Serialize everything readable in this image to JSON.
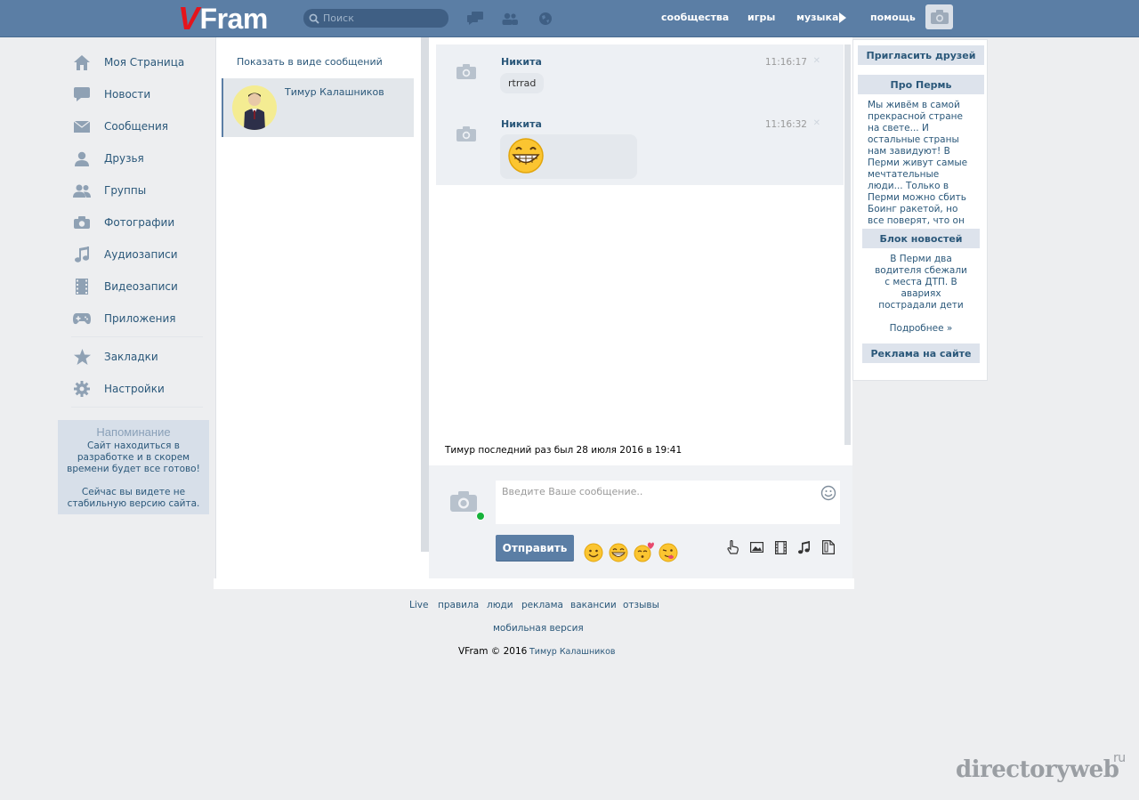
{
  "header": {
    "logo_v": "V",
    "logo_rest": "Fram",
    "search_placeholder": "Поиск",
    "nav": [
      "сообщества",
      "игры",
      "музыка",
      "помощь"
    ]
  },
  "sidebar": {
    "items": [
      {
        "label": "Моя Страница",
        "icon": "home-icon"
      },
      {
        "label": "Новости",
        "icon": "news-icon"
      },
      {
        "label": "Сообщения",
        "icon": "envelope-icon"
      },
      {
        "label": "Друзья",
        "icon": "user-icon"
      },
      {
        "label": "Группы",
        "icon": "group-icon"
      },
      {
        "label": "Фотографии",
        "icon": "camera-icon"
      },
      {
        "label": "Аудиозаписи",
        "icon": "music-note-icon"
      },
      {
        "label": "Видеозаписи",
        "icon": "film-icon"
      },
      {
        "label": "Приложения",
        "icon": "gamepad-icon"
      },
      {
        "label": "Закладки",
        "icon": "star-icon"
      },
      {
        "label": "Настройки",
        "icon": "gear-icon"
      }
    ],
    "reminder": {
      "title": "Напоминание",
      "text1": "Сайт находиться в разработке и в скорем времени будет все готово!",
      "text2": "Сейчас вы видете не стабильную версию сайта."
    }
  },
  "dialogs": {
    "show_as_messages": "Показать в виде сообщений",
    "active": {
      "name": "Тимур Калашников"
    }
  },
  "chat": {
    "messages": [
      {
        "author": "Никита",
        "time": "11:16:17",
        "text": "rtrrad",
        "type": "text"
      },
      {
        "author": "Никита",
        "time": "11:16:32",
        "text": "",
        "type": "emoji"
      }
    ],
    "last_seen": "Тимур последний раз был 28 июля 2016 в 19:41"
  },
  "compose": {
    "placeholder": "Введите Ваше сообщение..",
    "value": "",
    "send_label": "Отправить",
    "emojis": [
      "smile-emoji",
      "grin-emoji",
      "kiss-emoji",
      "wink-emoji"
    ],
    "attachments": [
      "hand-pointer-icon",
      "image-icon",
      "film-icon",
      "music-note-icon",
      "document-icon"
    ]
  },
  "right": {
    "invite": "Пригласить друзей",
    "about_title": "Про Пермь",
    "about_text": "Мы живём в самой прекрасной стране на свете... И остальные страны нам завидуют! В Перми живут самые мечтательные люди... Только в Перми можно сбить Боинг ракетой, но все поверят, что он взорвался сам.",
    "news_title": "Блок новостей",
    "news_text": "В Перми два водителя сбежали с места ДТП. В авариях пострадали дети",
    "more": "Подробнее »",
    "ads_title": "Реклама на сайте"
  },
  "footer": {
    "links": [
      "Live",
      "правила",
      "люди",
      "реклама",
      "вакансии",
      "отзывы"
    ],
    "mobile": "мобильная версия",
    "copyright": "VFram © 2016",
    "author": "Тимур Калашников"
  },
  "watermark": {
    "text": "directoryweb",
    "suffix": "ru"
  },
  "colors": {
    "header": "#5b7ea5",
    "link": "#2b587a",
    "accent_red": "#e5141b",
    "online": "#17b23a"
  }
}
